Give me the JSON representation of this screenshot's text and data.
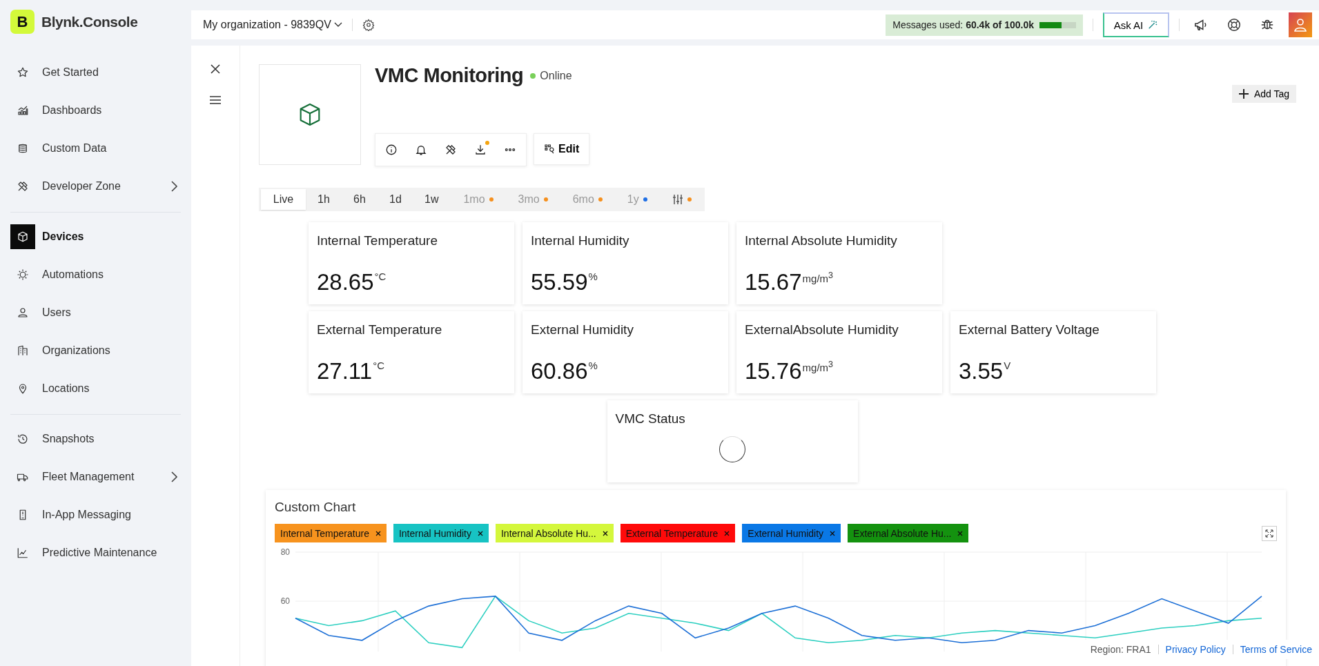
{
  "brand": {
    "logo_letter": "B",
    "name": "Blynk.Console"
  },
  "sidebar": {
    "groups": [
      [
        {
          "label": "Get Started",
          "selected": false,
          "expandable": false
        },
        {
          "label": "Dashboards",
          "selected": false,
          "expandable": false
        },
        {
          "label": "Custom Data",
          "selected": false,
          "expandable": false
        },
        {
          "label": "Developer Zone",
          "selected": false,
          "expandable": true
        }
      ],
      [
        {
          "label": "Devices",
          "selected": true,
          "expandable": false
        },
        {
          "label": "Automations",
          "selected": false,
          "expandable": false
        },
        {
          "label": "Users",
          "selected": false,
          "expandable": false
        },
        {
          "label": "Organizations",
          "selected": false,
          "expandable": false
        },
        {
          "label": "Locations",
          "selected": false,
          "expandable": false
        }
      ],
      [
        {
          "label": "Snapshots",
          "selected": false,
          "expandable": false
        },
        {
          "label": "Fleet Management",
          "selected": false,
          "expandable": true
        },
        {
          "label": "In-App Messaging",
          "selected": false,
          "expandable": false
        },
        {
          "label": "Predictive Maintenance",
          "selected": false,
          "expandable": false
        }
      ]
    ]
  },
  "topbar": {
    "organization": "My organization - 9839QV",
    "messages": {
      "text": "Messages used: **60.4k of 100.0k**",
      "level": 0.604
    },
    "ask_ai": "Ask AI"
  },
  "device": {
    "title": "VMC Monitoring",
    "status": "Online",
    "online": true,
    "add_tag": "Add Tag",
    "edit": "Edit",
    "download_badge": true
  },
  "tabs": [
    {
      "kind": "text",
      "label": "Live",
      "selected": true,
      "disabled": false
    },
    {
      "kind": "text",
      "label": "1h",
      "selected": false,
      "disabled": false
    },
    {
      "kind": "text",
      "label": "6h",
      "selected": false,
      "disabled": false
    },
    {
      "kind": "text",
      "label": "1d",
      "selected": false,
      "disabled": false
    },
    {
      "kind": "text",
      "label": "1w",
      "selected": false,
      "disabled": false
    },
    {
      "kind": "text",
      "label": "1mo",
      "selected": false,
      "disabled": true,
      "color": "#f5901e"
    },
    {
      "kind": "text",
      "label": "3mo",
      "selected": false,
      "disabled": true,
      "color": "#f5901e"
    },
    {
      "kind": "text",
      "label": "6mo",
      "selected": false,
      "disabled": true,
      "color": "#f5901e"
    },
    {
      "kind": "text",
      "label": "1y",
      "selected": false,
      "disabled": true,
      "color": "#1f6fe5"
    },
    {
      "kind": "icon",
      "selected": false,
      "disabled": true,
      "color": "#f5901e"
    }
  ],
  "tile_rows": [
    [
      {
        "title": "Internal Temperature",
        "value": "28.65",
        "unit": "°C"
      },
      {
        "title": "Internal Humidity",
        "value": "55.59",
        "unit": "%"
      },
      {
        "title": "Internal Absolute Humidity",
        "value": "15.67",
        "unit": "mg/m$^{3}$"
      }
    ],
    [
      {
        "title": "External Temperature",
        "value": "27.11",
        "unit": "°C"
      },
      {
        "title": "External Humidity",
        "value": "60.86",
        "unit": "%"
      },
      {
        "title": "ExternalAbsolute Humidity",
        "value": "15.76",
        "unit": "mg/m$^{3}$"
      },
      {
        "title": "External Battery Voltage",
        "value": "3.55",
        "unit": "V"
      }
    ],
    [
      {
        "title": "VMC Status",
        "loading": true
      }
    ]
  ],
  "custom_chart": {
    "title": "Custom Chart",
    "legend": [
      {
        "label": "Internal Temperature",
        "color": "#f7931e"
      },
      {
        "label": "Internal Humidity",
        "color": "#17c3c3"
      },
      {
        "label": "Internal Absolute Hu...",
        "color": "#d4f73c"
      },
      {
        "label": "External Temperature",
        "color": "#ff0a0a"
      },
      {
        "label": "External Humidity",
        "color": "#0a78e6"
      },
      {
        "label": "External Absolute Hu...",
        "color": "#14920f"
      }
    ],
    "chart_data": {
      "type": "line",
      "grid": true,
      "ylim": [
        40,
        80
      ],
      "yticks": [
        60,
        80
      ],
      "series": [
        {
          "color": "#2ccfc0",
          "values": [
            53,
            50,
            52,
            56,
            43,
            41,
            62,
            52,
            47,
            49,
            55,
            53,
            51,
            48,
            55,
            45,
            43,
            44,
            46,
            45,
            47,
            48,
            47,
            46,
            45,
            47,
            49,
            50,
            52,
            53
          ]
        },
        {
          "color": "#1c6fd6",
          "values": [
            53,
            46,
            44,
            52,
            58,
            61,
            62,
            47,
            44,
            52,
            58,
            55,
            45,
            49,
            55,
            58,
            53,
            46,
            44,
            45,
            43,
            44,
            48,
            47,
            50,
            55,
            61,
            56,
            51,
            62
          ]
        }
      ]
    }
  },
  "footer": {
    "region": "Region: FRA1",
    "links": [
      "Privacy Policy",
      "Terms of Service"
    ]
  }
}
